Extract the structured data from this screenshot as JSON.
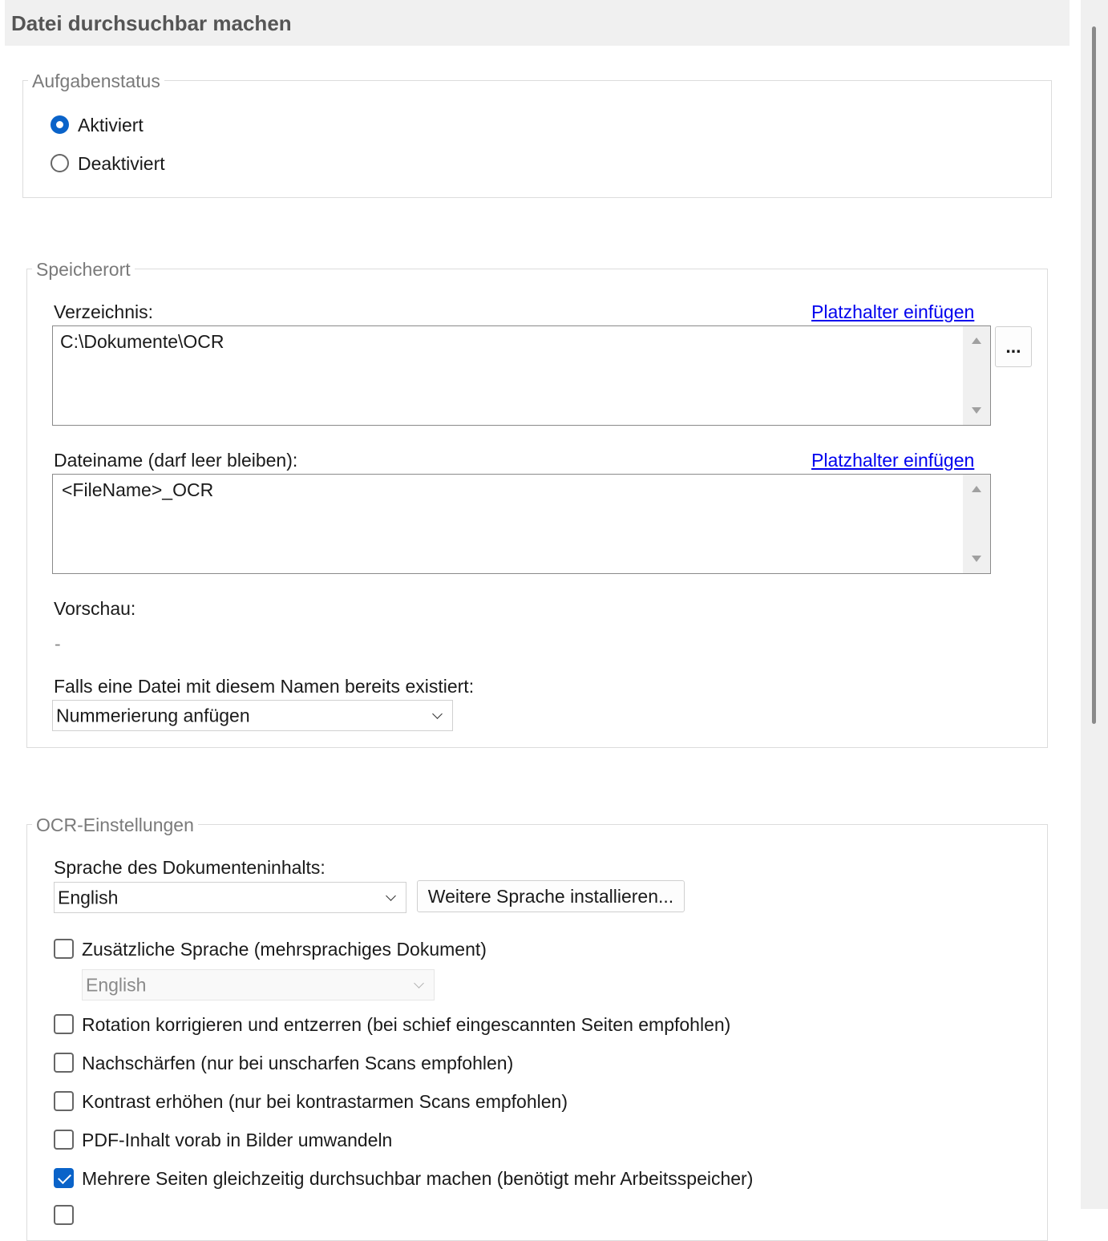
{
  "header": {
    "title": "Datei durchsuchbar machen"
  },
  "task_status": {
    "legend": "Aufgabenstatus",
    "options": [
      {
        "label": "Aktiviert",
        "checked": true
      },
      {
        "label": "Deaktiviert",
        "checked": false
      }
    ]
  },
  "location": {
    "legend": "Speicherort",
    "directory_label": "Verzeichnis:",
    "directory_insert_link": "Platzhalter einfügen",
    "directory_value": "C:\\Dokumente\\OCR",
    "browse_button": "...",
    "filename_label": "Dateiname (darf leer bleiben):",
    "filename_insert_link": "Platzhalter einfügen",
    "filename_value": "<FileName>_OCR",
    "preview_label": "Vorschau:",
    "preview_value": "-",
    "exists_label": "Falls eine Datei mit diesem Namen bereits existiert:",
    "exists_selected": "Nummerierung anfügen"
  },
  "ocr": {
    "legend": "OCR-Einstellungen",
    "language_label": "Sprache des Dokumenteninhalts:",
    "language_selected": "English",
    "install_button": "Weitere Sprache installieren...",
    "options": [
      {
        "label": "Zusätzliche Sprache (mehrsprachiges Dokument)",
        "checked": false
      },
      {
        "label": "Rotation korrigieren und entzerren (bei schief eingescannten Seiten empfohlen)",
        "checked": false
      },
      {
        "label": "Nachschärfen (nur bei unscharfen Scans empfohlen)",
        "checked": false
      },
      {
        "label": "Kontrast erhöhen (nur bei kontrastarmen Scans empfohlen)",
        "checked": false
      },
      {
        "label": "PDF-Inhalt vorab in Bilder umwandeln",
        "checked": false
      },
      {
        "label": "Mehrere Seiten gleichzeitig durchsuchbar machen (benötigt mehr Arbeitsspeicher)",
        "checked": true
      }
    ],
    "additional_language_selected": "English"
  },
  "colors": {
    "accent": "#0a63c9",
    "link": "#0000ee",
    "legend": "#7a7a7a"
  }
}
